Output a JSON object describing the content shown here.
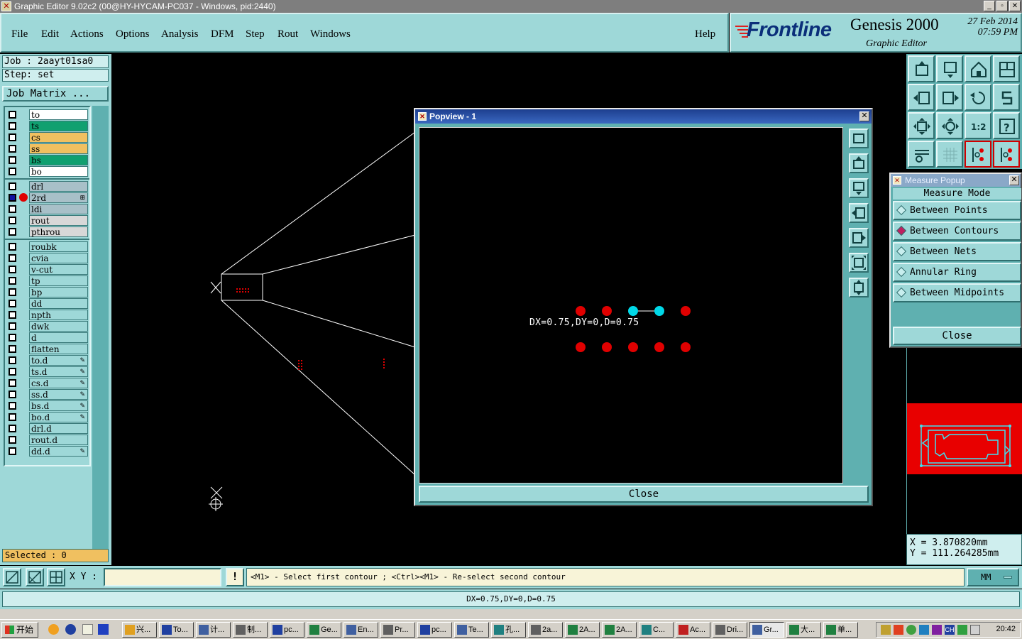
{
  "window": {
    "title": "Graphic Editor 9.02c2 (00@HY-HYCAM-PC037 - Windows, pid:2440)"
  },
  "menu": {
    "items": [
      "File",
      "Edit",
      "Actions",
      "Options",
      "Analysis",
      "DFM",
      "Step",
      "Rout",
      "Windows"
    ],
    "help": "Help"
  },
  "brand": {
    "logo": "Frontline",
    "product": "Genesis 2000",
    "subtitle": "Graphic Editor",
    "date": "27 Feb 2014",
    "time": "07:59 PM"
  },
  "job": {
    "job_line": "Job : 2aayt01sa0",
    "step_line": "Step: set",
    "matrix_button": "Job Matrix ..."
  },
  "layers": [
    {
      "name": "to",
      "color": "#ffffff"
    },
    {
      "name": "ts",
      "color": "#10a070"
    },
    {
      "name": "cs",
      "color": "#f0c060"
    },
    {
      "name": "ss",
      "color": "#f0c060"
    },
    {
      "name": "bs",
      "color": "#10a070"
    },
    {
      "name": "bo",
      "color": "#ffffff"
    },
    {
      "name": "drl",
      "color": "#a8c0c8"
    },
    {
      "name": "2rd",
      "color": "#a8c0c8",
      "selected": true,
      "active": true,
      "mark": "⊞"
    },
    {
      "name": "ldi",
      "color": "#a8c0c8"
    },
    {
      "name": "rout",
      "color": "#d8d8d8"
    },
    {
      "name": "pthrou",
      "color": "#d8d8d8"
    },
    {
      "name": "roubk",
      "color": "#9ed8d8"
    },
    {
      "name": "cvia",
      "color": "#9ed8d8"
    },
    {
      "name": "v-cut",
      "color": "#9ed8d8"
    },
    {
      "name": "tp",
      "color": "#9ed8d8"
    },
    {
      "name": "bp",
      "color": "#9ed8d8"
    },
    {
      "name": "dd",
      "color": "#9ed8d8"
    },
    {
      "name": "npth",
      "color": "#9ed8d8"
    },
    {
      "name": "dwk",
      "color": "#9ed8d8"
    },
    {
      "name": "d",
      "color": "#9ed8d8"
    },
    {
      "name": "flatten",
      "color": "#9ed8d8"
    },
    {
      "name": "to.d",
      "color": "#9ed8d8",
      "mark": "✎"
    },
    {
      "name": "ts.d",
      "color": "#9ed8d8",
      "mark": "✎"
    },
    {
      "name": "cs.d",
      "color": "#9ed8d8",
      "mark": "✎"
    },
    {
      "name": "ss.d",
      "color": "#9ed8d8",
      "mark": "✎"
    },
    {
      "name": "bs.d",
      "color": "#9ed8d8",
      "mark": "✎"
    },
    {
      "name": "bo.d",
      "color": "#9ed8d8",
      "mark": "✎"
    },
    {
      "name": "drl.d",
      "color": "#9ed8d8"
    },
    {
      "name": "rout.d",
      "color": "#9ed8d8"
    },
    {
      "name": "dd.d",
      "color": "#9ed8d8",
      "mark": "✎"
    }
  ],
  "selected_text": "Selected : 0",
  "popview": {
    "title": "Popview - 1",
    "measurement": "DX=0.75,DY=0,D=0.75",
    "close": "Close"
  },
  "measure_popup": {
    "title": "Measure Popup",
    "header": "Measure Mode",
    "options": [
      {
        "label": "Between Points",
        "active": false
      },
      {
        "label": "Between Contours",
        "active": true
      },
      {
        "label": "Between Nets",
        "active": false
      },
      {
        "label": "Annular Ring",
        "active": false
      },
      {
        "label": "Between Midpoints",
        "active": false
      }
    ],
    "close": "Close"
  },
  "coords": {
    "x": "X = 3.870820mm",
    "y": "Y = 111.264285mm"
  },
  "command": {
    "xy_label": "X Y :",
    "xy_value": "",
    "info": "!",
    "prompt": "<M1> - Select first contour ; <Ctrl><M1> - Re-select second contour",
    "units": "MM"
  },
  "status": "DX=0.75,DY=0,D=0.75",
  "taskbar": {
    "start": "开始",
    "tasks": [
      "兴...",
      "To...",
      "计...",
      "制...",
      "pc...",
      "Ge...",
      "En...",
      "Pr...",
      "pc...",
      "Te...",
      "孔...",
      "2a...",
      "2A...",
      "2A...",
      "C...",
      "Ac...",
      "Dri...",
      "Gr...",
      "大...",
      "单..."
    ],
    "clock": "20:42"
  },
  "colors": {
    "panel": "#9ed8d8",
    "dark_teal": "#5fb0b0",
    "pad_red": "#e00000",
    "pad_cyan": "#00d8e8"
  }
}
